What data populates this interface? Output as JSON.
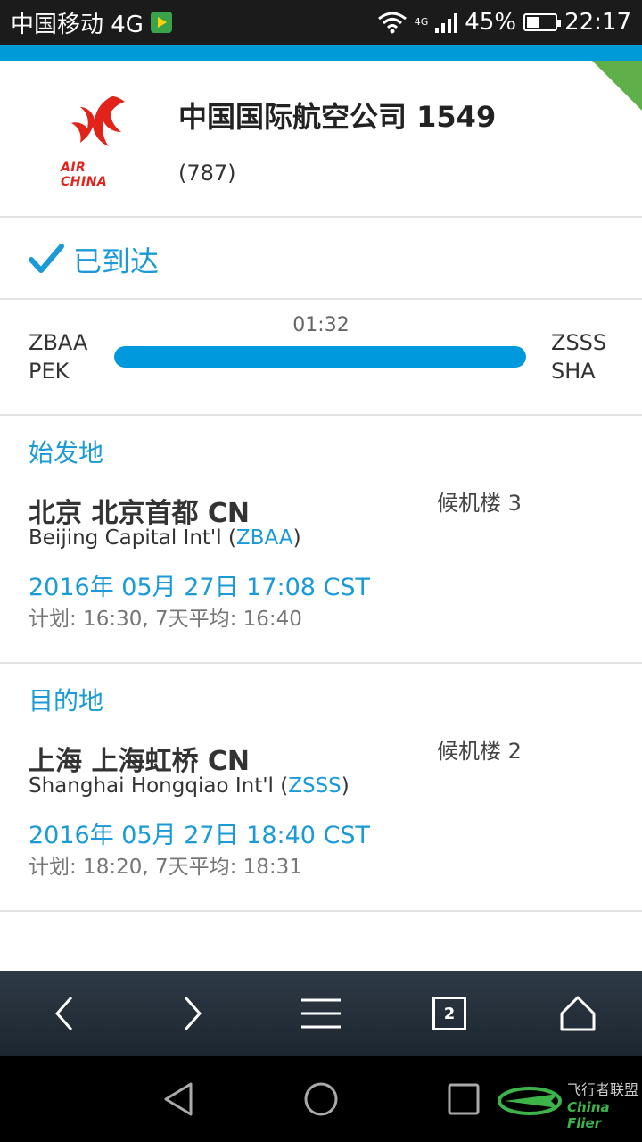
{
  "status_bar": {
    "carrier": "中国移动 4G",
    "network_small": "4G",
    "battery": "45%",
    "battery_level": 0.45,
    "time": "22:17"
  },
  "header": {
    "airline_logo_text": "AIR CHINA",
    "flight_title": "中国国际航空公司 1549",
    "aircraft": "(787)"
  },
  "status": {
    "label": "已到达"
  },
  "route": {
    "origin_icao": "ZBAA",
    "origin_iata": "PEK",
    "dest_icao": "ZSSS",
    "dest_iata": "SHA",
    "duration": "01:32",
    "progress": 1.0
  },
  "origin": {
    "heading": "始发地",
    "city": "北京 北京首都 CN",
    "terminal": "候机楼 3",
    "airport_name": "Beijing Capital Int'l (",
    "airport_code": "ZBAA",
    "airport_close": ")",
    "actual_time": "2016年 05月 27日 17:08 CST",
    "plan": "计划: 16:30, 7天平均: 16:40"
  },
  "destination": {
    "heading": "目的地",
    "city": "上海 上海虹桥 CN",
    "terminal": "候机楼 2",
    "airport_name": "Shanghai Hongqiao Int'l (",
    "airport_code": "ZSSS",
    "airport_close": ")",
    "actual_time": "2016年 05月 27日 18:40 CST",
    "plan": "计划: 18:20, 7天平均: 18:31"
  },
  "browser": {
    "tab_count": "2"
  },
  "watermark": {
    "cn": "飞行者联盟",
    "en": "China Flier"
  },
  "colors": {
    "accent": "#1a9ad6",
    "strip": "#009ad9",
    "airline_red": "#e2231a"
  }
}
